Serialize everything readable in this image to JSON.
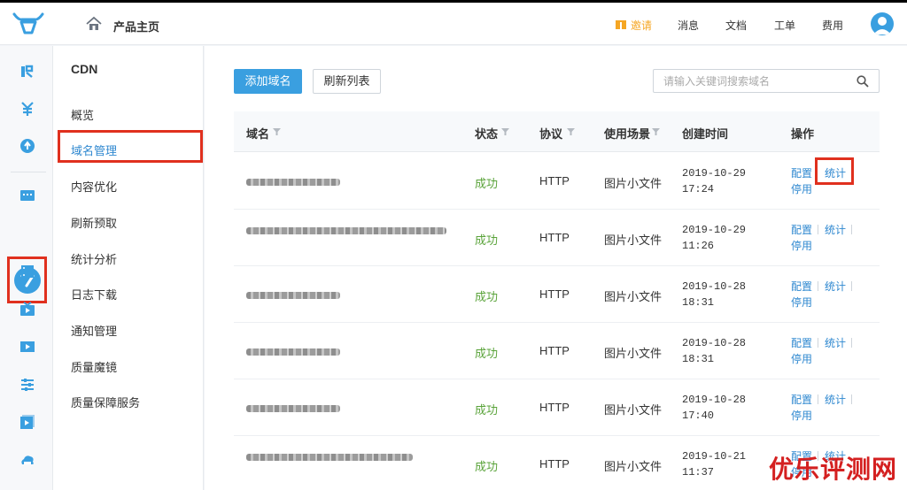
{
  "header": {
    "title": "产品主页",
    "nav": {
      "invite": "邀请",
      "messages": "消息",
      "docs": "文档",
      "tickets": "工单",
      "billing": "费用"
    }
  },
  "subnav": {
    "title": "CDN",
    "items": [
      "概览",
      "域名管理",
      "内容优化",
      "刷新预取",
      "统计分析",
      "日志下载",
      "通知管理",
      "质量魔镜",
      "质量保障服务"
    ]
  },
  "toolbar": {
    "add_label": "添加域名",
    "refresh_label": "刷新列表",
    "search_placeholder": "请输入关键词搜索域名"
  },
  "table": {
    "headers": {
      "domain": "域名",
      "status": "状态",
      "protocol": "协议",
      "scene": "使用场景",
      "created": "创建时间",
      "actions": "操作"
    },
    "rows": [
      {
        "status": "成功",
        "protocol": "HTTP",
        "scene": "图片小文件",
        "date": "2019-10-29",
        "time": "17:24",
        "config": "配置",
        "stats": "统计",
        "disable": "停用"
      },
      {
        "status": "成功",
        "protocol": "HTTP",
        "scene": "图片小文件",
        "date": "2019-10-29",
        "time": "11:26",
        "config": "配置",
        "stats": "统计",
        "disable": "停用"
      },
      {
        "status": "成功",
        "protocol": "HTTP",
        "scene": "图片小文件",
        "date": "2019-10-28",
        "time": "18:31",
        "config": "配置",
        "stats": "统计",
        "disable": "停用"
      },
      {
        "status": "成功",
        "protocol": "HTTP",
        "scene": "图片小文件",
        "date": "2019-10-28",
        "time": "18:31",
        "config": "配置",
        "stats": "统计",
        "disable": "停用"
      },
      {
        "status": "成功",
        "protocol": "HTTP",
        "scene": "图片小文件",
        "date": "2019-10-28",
        "time": "17:40",
        "config": "配置",
        "stats": "统计",
        "disable": "停用"
      },
      {
        "status": "成功",
        "protocol": "HTTP",
        "scene": "图片小文件",
        "date": "2019-10-21",
        "time": "11:37",
        "config": "配置",
        "stats": "统计",
        "disable": "停用"
      }
    ]
  },
  "watermark": "优乐评测网",
  "colors": {
    "accent": "#3a9fe0",
    "link": "#2f88d0",
    "success": "#5aa33a",
    "highlight": "#e0301e",
    "invite": "#f5a623"
  }
}
